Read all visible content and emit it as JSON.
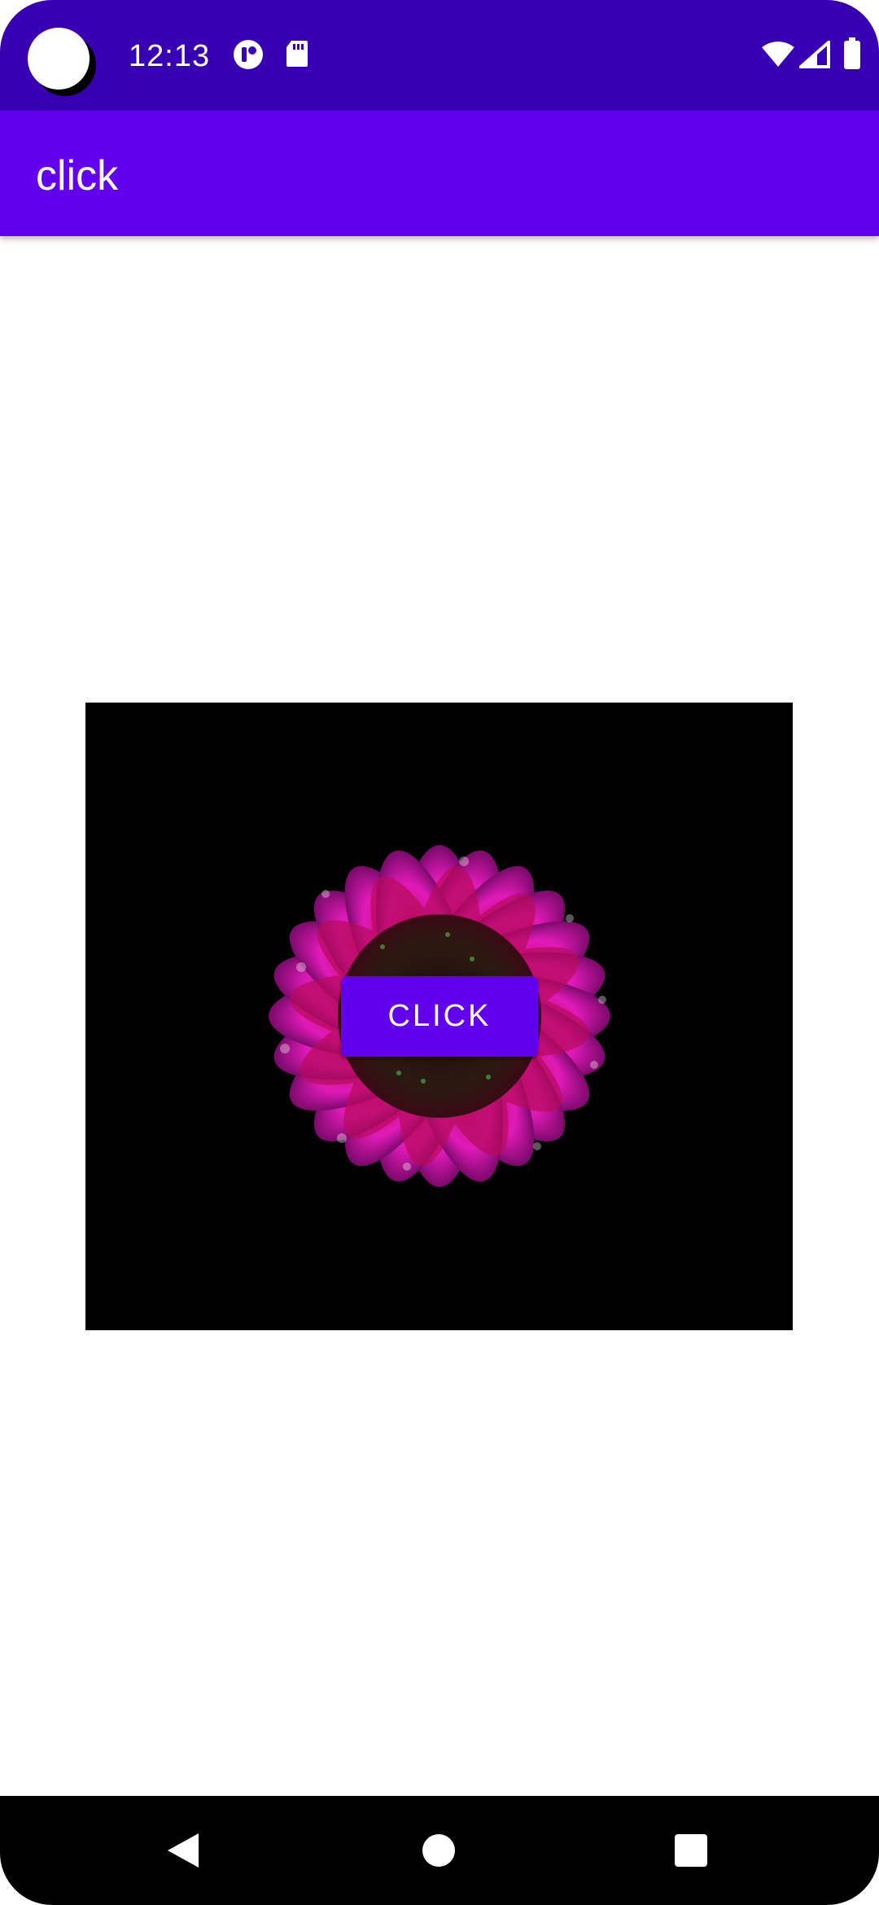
{
  "status_bar": {
    "time": "12:13",
    "icons": [
      "notification-app-icon",
      "sd-card-icon",
      "wifi-icon",
      "signal-icon",
      "battery-icon"
    ]
  },
  "app_bar": {
    "title": "click"
  },
  "main": {
    "image": {
      "description_icon": "flower-image"
    },
    "button": {
      "label": "CLICK"
    }
  },
  "nav_bar": {
    "icons": [
      "back-icon",
      "home-icon",
      "recents-icon"
    ]
  },
  "colors": {
    "status_bar": "#3700b3",
    "app_bar": "#6200ee",
    "button": "#6200ee",
    "background": "#ffffff"
  }
}
